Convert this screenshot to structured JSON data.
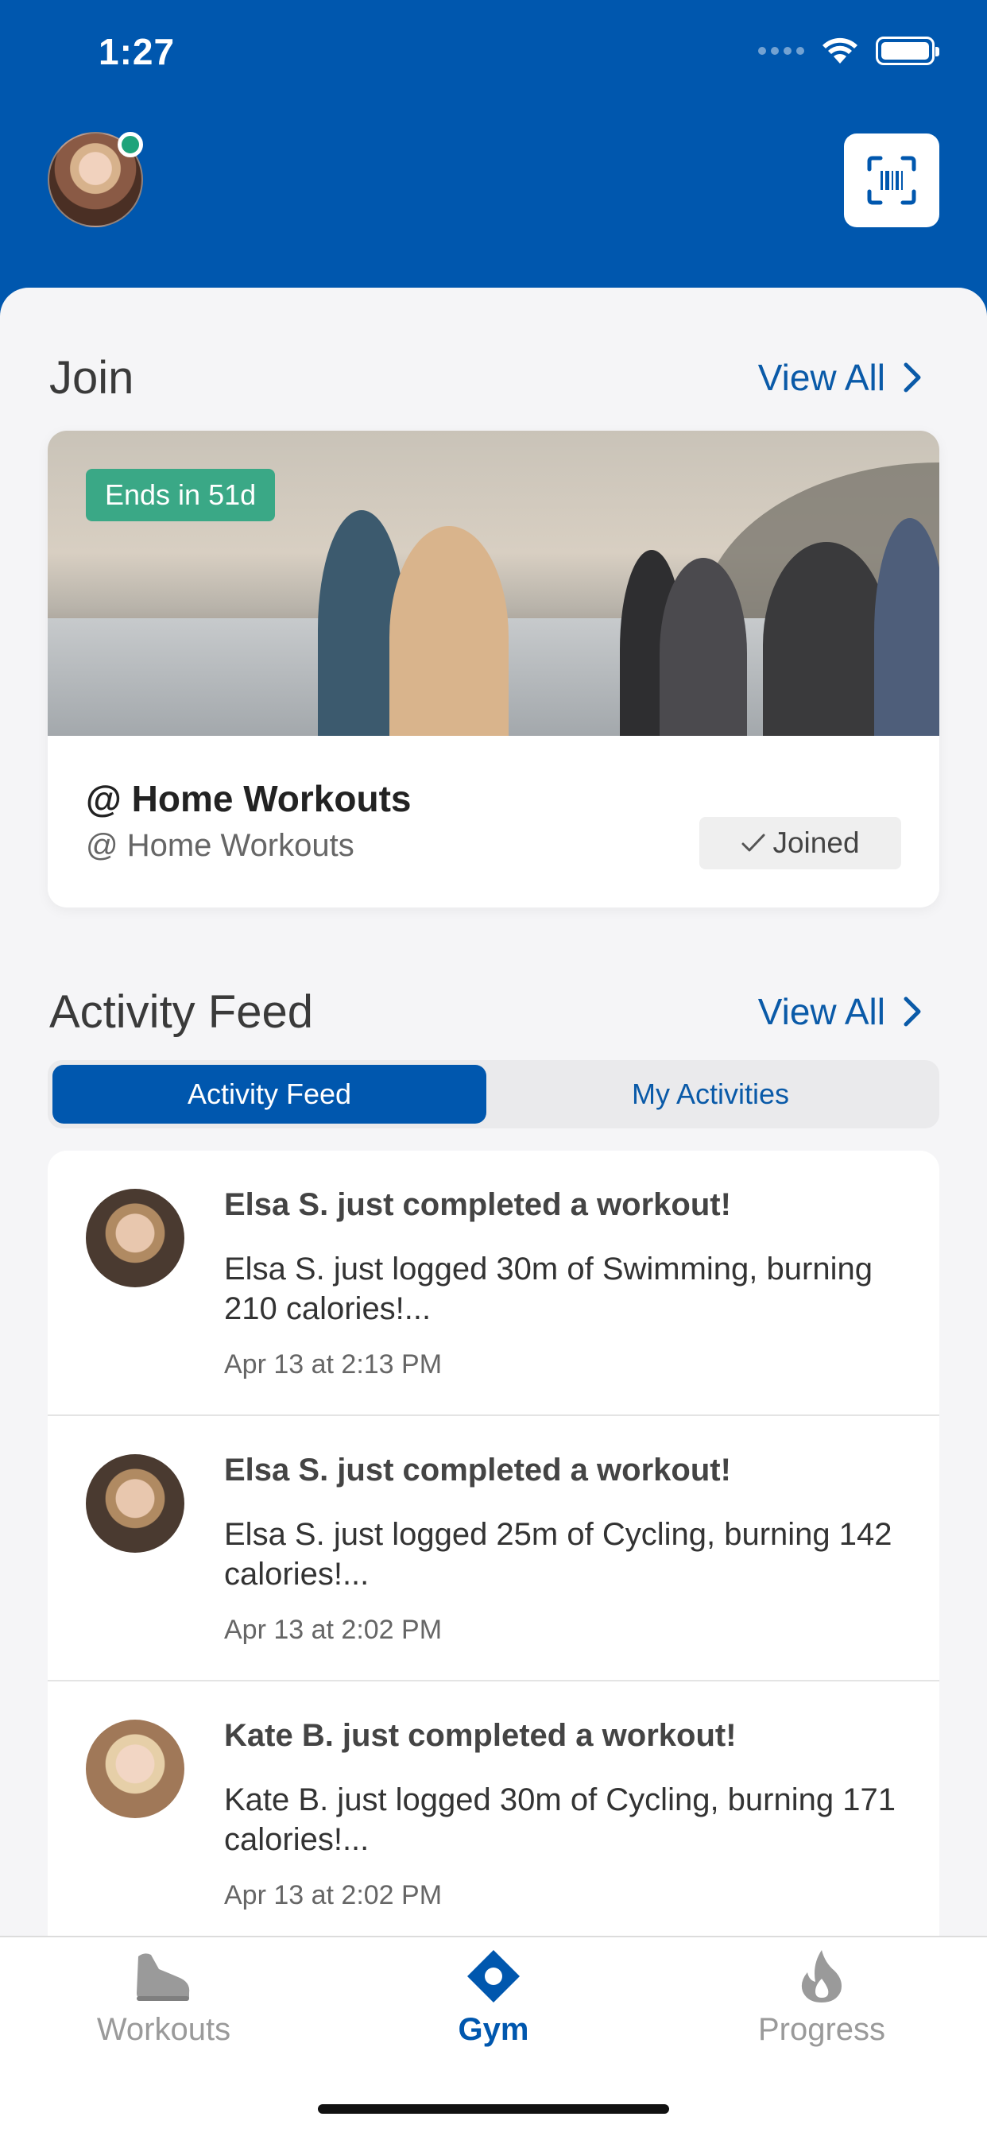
{
  "status_bar": {
    "time": "1:27"
  },
  "colors": {
    "brand": "#0057ae",
    "accent_green": "#3aa886",
    "online_dot": "#1ea37a"
  },
  "join": {
    "title": "Join",
    "view_all": "View All",
    "card": {
      "badge": "Ends in 51d",
      "title": "@ Home Workouts",
      "subtitle": "@ Home Workouts",
      "joined_label": "Joined"
    }
  },
  "activity": {
    "title": "Activity Feed",
    "view_all": "View All",
    "tabs": [
      {
        "label": "Activity Feed",
        "active": true
      },
      {
        "label": "My Activities",
        "active": false
      }
    ],
    "items": [
      {
        "title": "Elsa S. just completed a workout!",
        "body": "Elsa S. just logged 30m of Swimming, burning 210 calories!...",
        "time": "Apr 13 at 2:13 PM"
      },
      {
        "title": "Elsa S. just completed a workout!",
        "body": "Elsa S. just logged 25m of Cycling, burning 142 calories!...",
        "time": "Apr 13 at 2:02 PM"
      },
      {
        "title": "Kate B. just completed a workout!",
        "body": "Kate B. just logged 30m of Cycling, burning 171 calories!...",
        "time": "Apr 13 at 2:02 PM"
      }
    ]
  },
  "tabbar": [
    {
      "label": "Workouts",
      "icon": "shoe-icon",
      "active": false
    },
    {
      "label": "Gym",
      "icon": "location-diamond-icon",
      "active": true
    },
    {
      "label": "Progress",
      "icon": "flame-icon",
      "active": false
    }
  ]
}
